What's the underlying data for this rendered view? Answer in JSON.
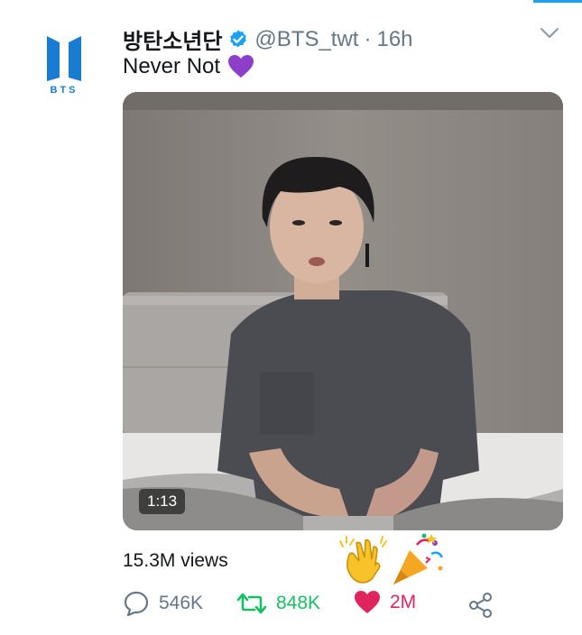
{
  "account": {
    "display_name": "방탄소년단",
    "handle": "@BTS_twt",
    "separator": "·",
    "time": "16h",
    "logo_text": "BTS",
    "verified_color": "#1da1f2",
    "brand_color": "#1a7bd3"
  },
  "tweet": {
    "text": "Never Not",
    "emoji": "purple-heart"
  },
  "video": {
    "duration": "1:13",
    "views": "15.3M views"
  },
  "reactions": [
    "clapping-hands",
    "party-popper"
  ],
  "actions": {
    "reply_count": "546K",
    "retweet_count": "848K",
    "like_count": "2M",
    "retweet_color": "#17bf63",
    "like_color": "#e0245e"
  },
  "icons": {
    "reply": "comment-bubble-icon",
    "retweet": "retweet-arrows-icon",
    "like": "heart-icon",
    "share": "share-icon",
    "more": "chevron-down-icon"
  }
}
